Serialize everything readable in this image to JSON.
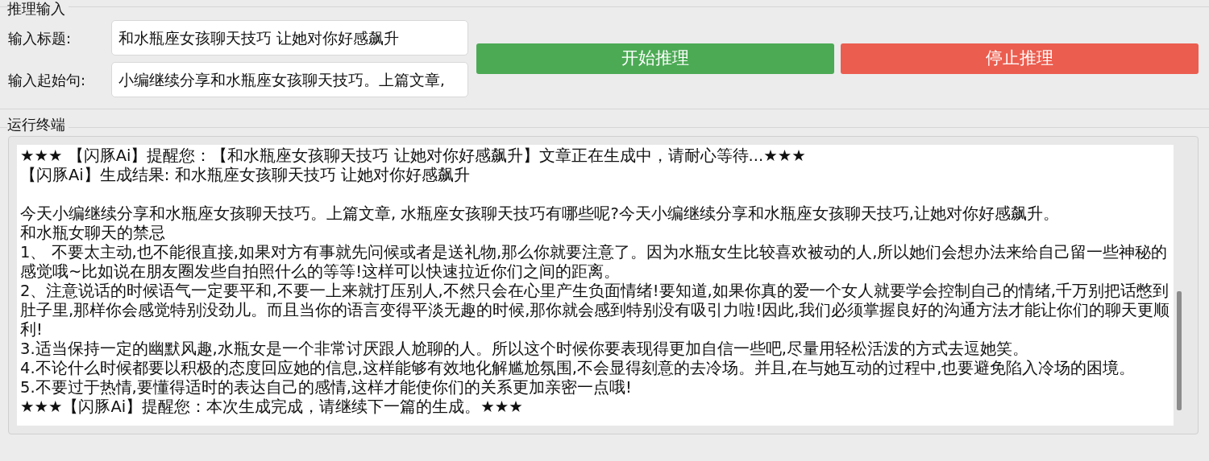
{
  "input_group": {
    "title": "推理输入",
    "fields": [
      {
        "label": "输入标题:",
        "value": "和水瓶座女孩聊天技巧 让她对你好感飙升"
      },
      {
        "label": "输入起始句:",
        "value": "小编继续分享和水瓶座女孩聊天技巧。上篇文章,"
      }
    ],
    "buttons": [
      {
        "label": "开始推理",
        "kind": "start"
      },
      {
        "label": "停止推理",
        "kind": "stop"
      }
    ]
  },
  "terminal_group": {
    "title": "运行终端",
    "header_lines": [
      "★★★ 【闪豚Ai】提醒您：【和水瓶座女孩聊天技巧 让她对你好感飙升】文章正在生成中，请耐心等待...★★★",
      "【闪豚Ai】生成结果: 和水瓶座女孩聊天技巧 让她对你好感飙升"
    ],
    "body_lines": [
      "今天小编继续分享和水瓶座女孩聊天技巧。上篇文章, 水瓶座女孩聊天技巧有哪些呢?今天小编继续分享和水瓶座女孩聊天技巧,让她对你好感飙升。",
      "和水瓶女聊天的禁忌",
      "1、 不要太主动,也不能很直接,如果对方有事就先问候或者是送礼物,那么你就要注意了。因为水瓶女生比较喜欢被动的人,所以她们会想办法来给自己留一些神秘的感觉哦~比如说在朋友圈发些自拍照什么的等等!这样可以快速拉近你们之间的距离。",
      "2、注意说话的时候语气一定要平和,不要一上来就打压别人,不然只会在心里产生负面情绪!要知道,如果你真的爱一个女人就要学会控制自己的情绪,千万别把话憋到肚子里,那样你会感觉特别没劲儿。而且当你的语言变得平淡无趣的时候,那你就会感到特别没有吸引力啦!因此,我们必须掌握良好的沟通方法才能让你们的聊天更顺利!",
      "3.适当保持一定的幽默风趣,水瓶女是一个非常讨厌跟人尬聊的人。所以这个时候你要表现得更加自信一些吧,尽量用轻松活泼的方式去逗她笑。",
      "4.不论什么时候都要以积极的态度回应她的信息,这样能够有效地化解尴尬氛围,不会显得刻意的去冷场。并且,在与她互动的过程中,也要避免陷入冷场的困境。",
      "5.不要过于热情,要懂得适时的表达自己的感情,这样才能使你们的关系更加亲密一点哦!",
      "★★★【闪豚Ai】提醒您：本次生成完成，请继续下一篇的生成。★★★"
    ]
  }
}
